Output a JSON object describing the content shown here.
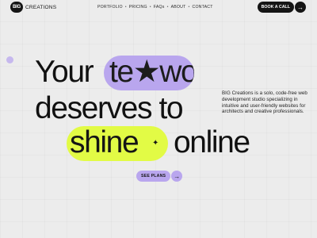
{
  "header": {
    "logo_mark": "BIG",
    "logo_text": "CREATIONS",
    "nav": [
      "PORTFOLIO",
      "PRICING",
      "FAQs",
      "ABOUT",
      "CONTACT"
    ],
    "nav_separator": "•",
    "cta_label": "BOOK A CALL",
    "cta_icon": "arrow-right-icon"
  },
  "hero": {
    "line1_prefix": "Your",
    "line1_pill": "te★wo",
    "line2": "deserves to",
    "line3_pill": "shine",
    "line3_suffix": "online",
    "pill_purple_color": "#b9a6ee",
    "pill_green_color": "#e2fb45",
    "description": "BIG Creations is a solo, code-free web development studio specializing in intuitive and user-friendly websites for architects and creative professionals.",
    "button_label": "SEE PLANS",
    "button_icon": "arrow-right-icon"
  },
  "colors": {
    "background": "#ececec",
    "dark": "#151515",
    "accent_purple": "#b9a6ee",
    "accent_green": "#e2fb45"
  }
}
